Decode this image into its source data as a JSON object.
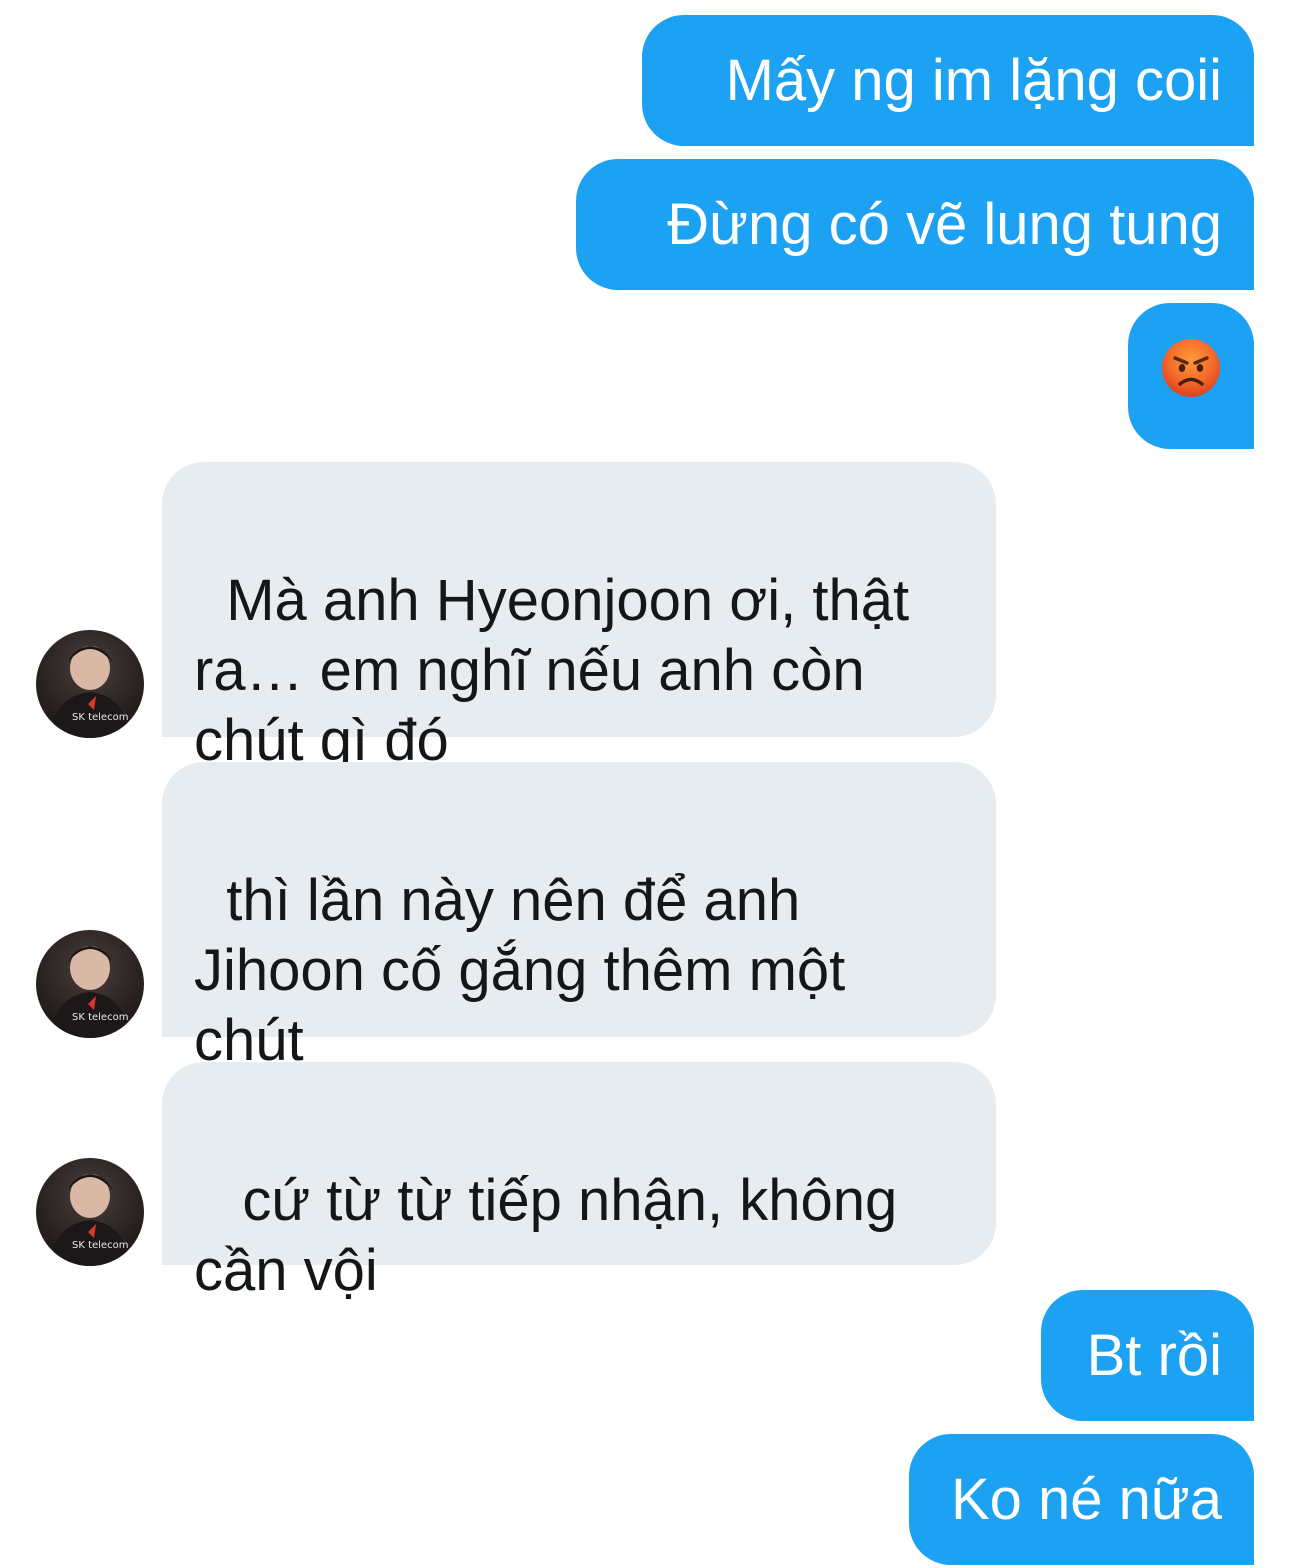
{
  "messages": [
    {
      "id": "m1",
      "side": "outgoing",
      "text": "Mấy ng im lặng coii"
    },
    {
      "id": "m2",
      "side": "outgoing",
      "text": "Đừng có vẽ lung tung"
    },
    {
      "id": "m3",
      "side": "outgoing",
      "emoji": "angry-face"
    },
    {
      "id": "m4",
      "side": "incoming",
      "text": "Mà anh Hyeonjoon ơi, thật\nra… em nghĩ nếu anh còn\nchút gì đó"
    },
    {
      "id": "m5",
      "side": "incoming",
      "text": "thì lần này nên để anh\nJihoon cố gắng thêm một\nchút"
    },
    {
      "id": "m6",
      "side": "incoming",
      "text": " cứ từ từ tiếp nhận, không\ncần vội"
    },
    {
      "id": "m7",
      "side": "outgoing",
      "text": "Bt rồi"
    },
    {
      "id": "m8",
      "side": "outgoing",
      "text": "Ko né nữa"
    }
  ],
  "avatar": {
    "logo_text": "SK telecom"
  },
  "colors": {
    "outgoing_bubble": "#1DA1F2",
    "incoming_bubble": "#E6ECF0",
    "outgoing_text": "#FFFFFF",
    "incoming_text": "#14171A"
  }
}
